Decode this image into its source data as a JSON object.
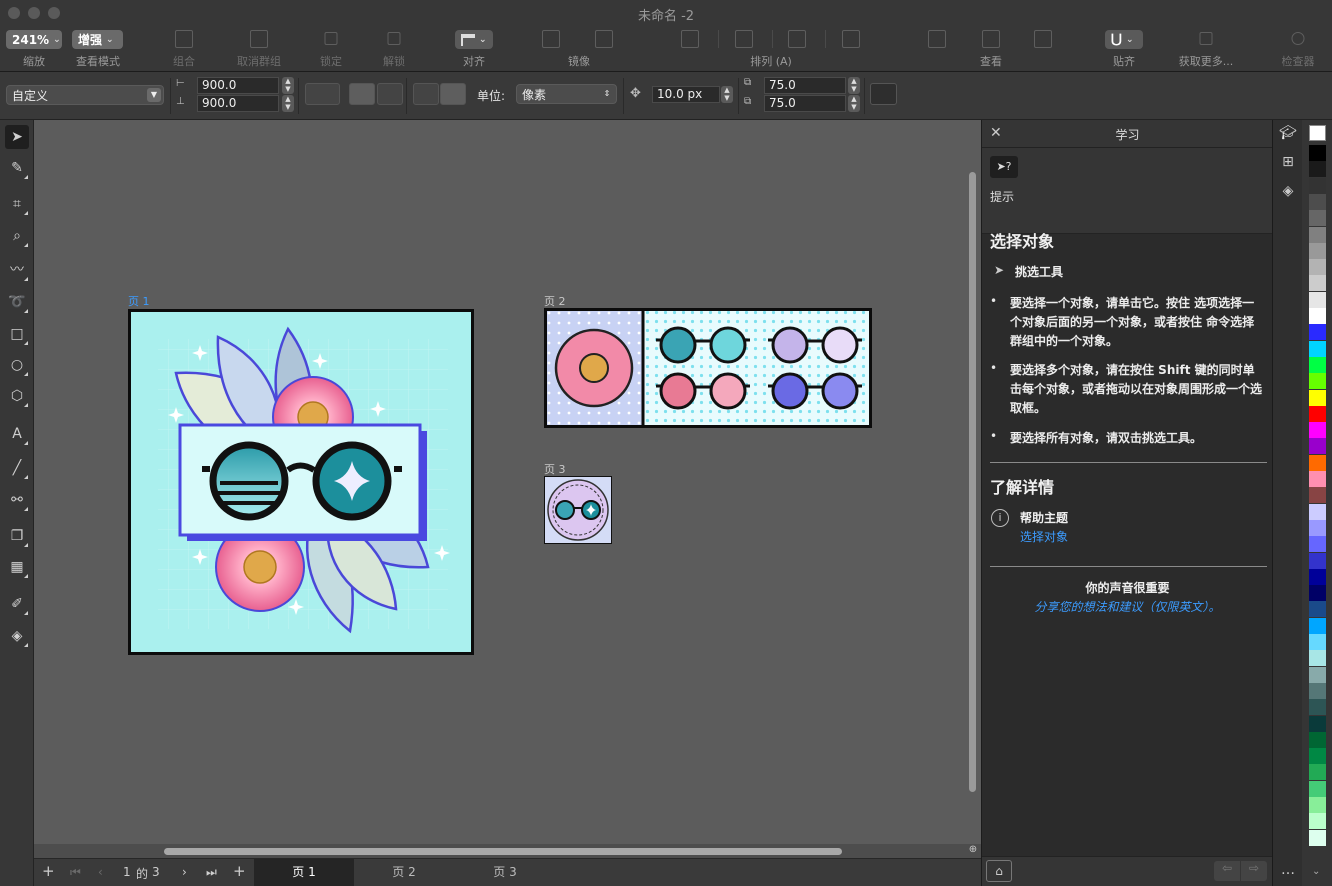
{
  "window": {
    "title": "未命名 -2"
  },
  "toolbar": {
    "zoom_value": "241%",
    "view_mode_value": "增强",
    "labels": {
      "zoom": "缩放",
      "view_mode": "查看模式",
      "group": "组合",
      "ungroup": "取消群组",
      "lock": "锁定",
      "unlock": "解锁",
      "align": "对齐",
      "mirror": "镜像",
      "arrange": "排列 (A)",
      "view": "查看",
      "snap": "贴齐",
      "get_more": "获取更多...",
      "inspect": "检查器"
    }
  },
  "propbar": {
    "preset": "自定义",
    "width": "900.0",
    "height": "900.0",
    "units_label": "单位:",
    "units_value": "像素",
    "nudge": "10.0 px",
    "dup_x": "75.0",
    "dup_y": "75.0"
  },
  "canvas": {
    "pages": [
      {
        "label": "页 1",
        "active": true
      },
      {
        "label": "页 2",
        "active": false
      },
      {
        "label": "页 3",
        "active": false
      }
    ]
  },
  "pagenav": {
    "current": "1",
    "of": "的",
    "total": "3",
    "tabs": [
      "页 1",
      "页 2",
      "页 3"
    ]
  },
  "docker": {
    "title": "学习",
    "hints_label": "提示",
    "section_title": "选择对象",
    "tool_name": "挑选工具",
    "bullets": [
      "要选择一个对象，请单击它。按住 选项选择一个对象后面的另一个对象，或者按住 命令选择群组中的一个对象。",
      "要选择多个对象，请在按住 Shift 键的同时单击每个对象，或者拖动以在对象周围形成一个选取框。",
      "要选择所有对象，请双击挑选工具。"
    ],
    "learn_more_title": "了解详情",
    "help_topics_label": "帮助主题",
    "help_link": "选择对象",
    "feedback_title": "你的声音很重要",
    "feedback_link": "分享您的想法和建议（仅限英文）。"
  },
  "palette_colors": [
    "#ffffff",
    "#000000",
    "#1a1a1a",
    "#333333",
    "#4d4d4d",
    "#666666",
    "#808080",
    "#999999",
    "#b3b3b3",
    "#cccccc",
    "#e6e6e6",
    "#ffffff",
    "#2a2aff",
    "#00d5ff",
    "#00ff44",
    "#66ff00",
    "#ffff00",
    "#ff0000",
    "#ff00ff",
    "#9900cc",
    "#ff6a00",
    "#ff8fb0",
    "#884444",
    "#ccccff",
    "#9999ff",
    "#6666ff",
    "#3333cc",
    "#000099",
    "#000066",
    "#1a4a8a",
    "#00a6ff",
    "#66d9ff",
    "#a8e6e6",
    "#88aaaa",
    "#557777",
    "#2d5555",
    "#0a3a3a",
    "#006633",
    "#008844",
    "#22aa55",
    "#44cc77",
    "#88ee99",
    "#bbffcc",
    "#ddffee"
  ]
}
